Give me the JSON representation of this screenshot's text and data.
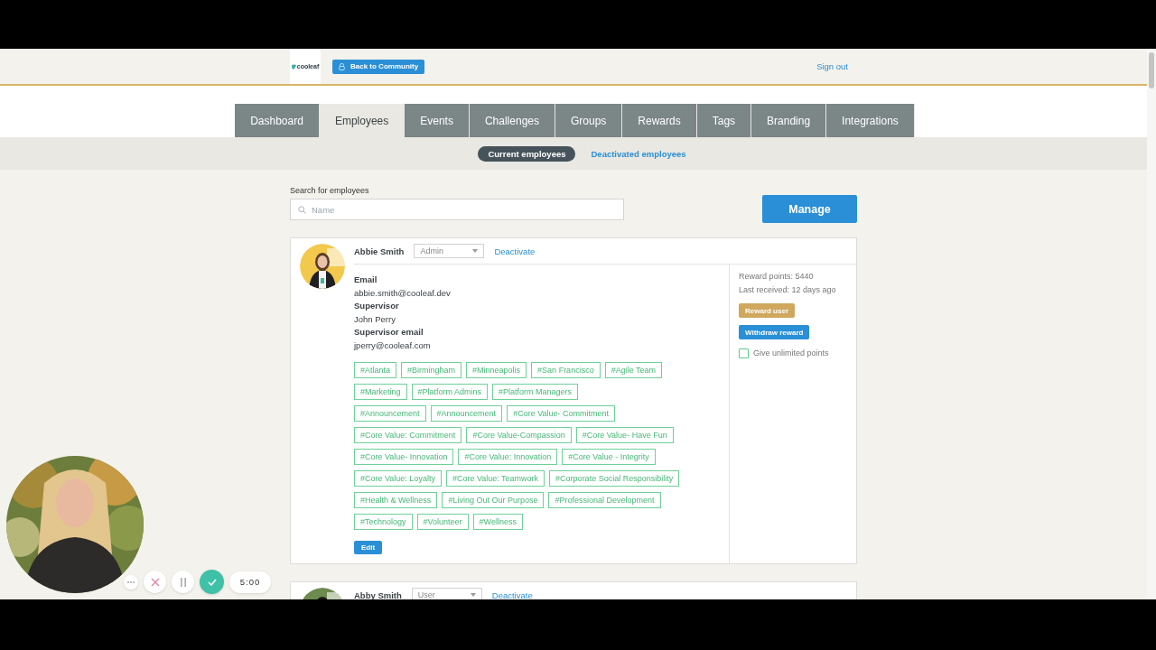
{
  "header": {
    "logo": "cooleaf",
    "back_button": "Back to Community",
    "sign_out": "Sign out"
  },
  "tabs": [
    {
      "label": "Dashboard",
      "selected": false
    },
    {
      "label": "Employees",
      "selected": true
    },
    {
      "label": "Events",
      "selected": false
    },
    {
      "label": "Challenges",
      "selected": false
    },
    {
      "label": "Groups",
      "selected": false
    },
    {
      "label": "Rewards",
      "selected": false
    },
    {
      "label": "Tags",
      "selected": false
    },
    {
      "label": "Branding",
      "selected": false
    },
    {
      "label": "Integrations",
      "selected": false
    }
  ],
  "subtabs": [
    {
      "label": "Current employees",
      "selected": true
    },
    {
      "label": "Deactivated employees",
      "selected": false
    }
  ],
  "search": {
    "label": "Search for employees",
    "placeholder": "Name"
  },
  "manage_button": "Manage",
  "employees": [
    {
      "name": "Abbie Smith",
      "role": "Admin",
      "deactivate": "Deactivate",
      "details": [
        {
          "label": "Email",
          "value": "abbie.smith@cooleaf.dev"
        },
        {
          "label": "Supervisor",
          "value": "John Perry"
        },
        {
          "label": "Supervisor email",
          "value": "jperry@cooleaf.com"
        }
      ],
      "tag_rows": [
        [
          "#Atlanta",
          "#Birmingham",
          "#Minneapolis",
          "#San Francisco",
          "#Agile Team"
        ],
        [
          "#Marketing",
          "#Platform Admins",
          "#Platform Managers"
        ],
        [
          "#Announcement",
          "#Announcement",
          "#Core Value- Commitment"
        ],
        [
          "#Core Value: Commitment",
          "#Core Value-Compassion",
          "#Core Value- Have Fun"
        ],
        [
          "#Core Value- Innovation",
          "#Core Value: Innovation",
          "#Core Value - Integrity"
        ],
        [
          "#Core Value: Loyalty",
          "#Core Value: Teamwork",
          "#Corporate Social Responsibility"
        ],
        [
          "#Health & Wellness",
          "#Living Out Our Purpose",
          "#Professional Development"
        ],
        [
          "#Technology",
          "#Volunteer",
          "#Wellness"
        ]
      ],
      "edit_button": "Edit",
      "rewards": {
        "points": "Reward points: 5440",
        "last_received": "Last received: 12 days ago",
        "reward_button": "Reward user",
        "withdraw_button": "Withdraw reward",
        "unlimited": {
          "label": "Give unlimited points",
          "checked": false
        }
      }
    },
    {
      "name": "Abby Smith",
      "role": "User",
      "deactivate": "Deactivate"
    }
  ],
  "recorder": {
    "timer": "5:00"
  }
}
